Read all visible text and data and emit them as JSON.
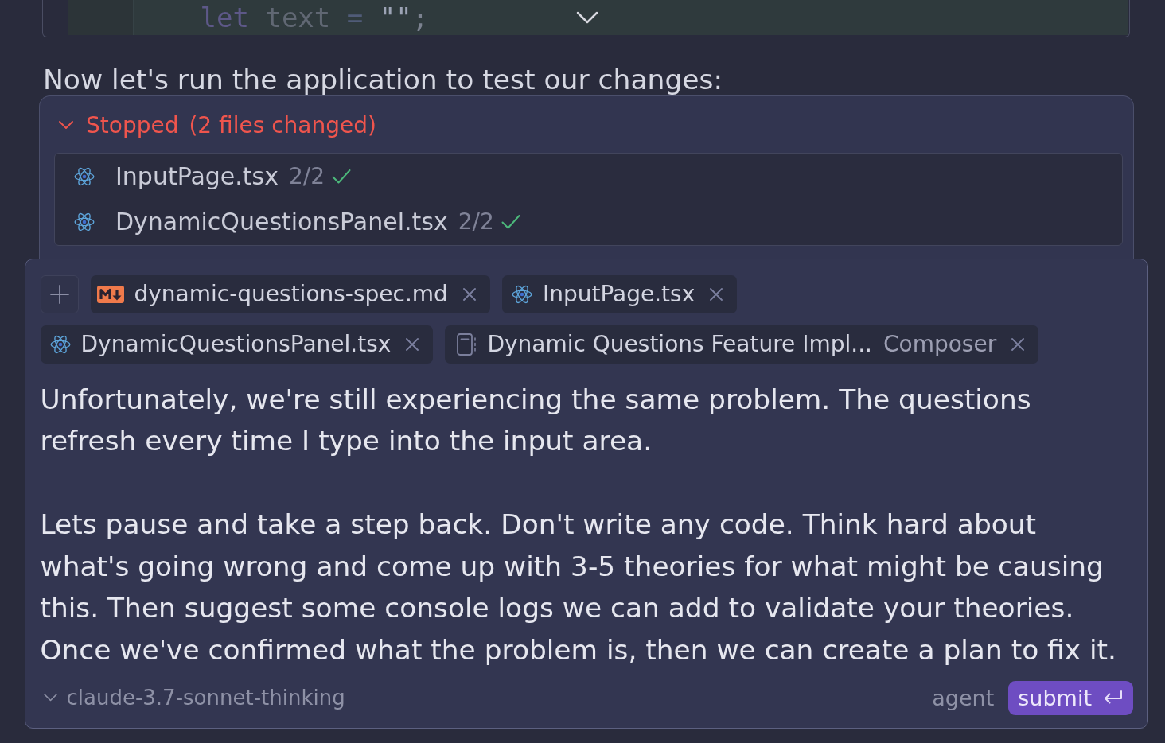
{
  "code_block": {
    "tokens": [
      {
        "kind": "keyword",
        "text": "let"
      },
      {
        "kind": "identifier",
        "text": "text"
      },
      {
        "kind": "operator",
        "text": "="
      },
      {
        "kind": "string",
        "text": "\"\""
      },
      {
        "kind": "punctuation",
        "text": ";"
      }
    ]
  },
  "assistant_text": "Now let's run the application to test our changes:",
  "run_panel": {
    "kind": "stopped",
    "status": "Stopped",
    "summary": "(2 files changed)",
    "expanded": true,
    "files": [
      {
        "kind": "react",
        "name": "InputPage.tsx",
        "progress": "2/2",
        "accepted": true
      },
      {
        "kind": "react",
        "name": "DynamicQuestionsPanel.tsx",
        "progress": "2/2",
        "accepted": true
      }
    ]
  },
  "composer": {
    "chips": [
      {
        "kind": "markdown",
        "label": "dynamic-questions-spec.md"
      },
      {
        "kind": "react",
        "label": "InputPage.tsx"
      },
      {
        "kind": "react",
        "label": "DynamicQuestionsPanel.tsx"
      },
      {
        "kind": "notebook",
        "label": "Dynamic Questions Feature Impl...",
        "detail": "Composer"
      }
    ],
    "message": "Unfortunately, we're still experiencing the same problem. The questions refresh every time I type into the input area.\n\nLets pause and take a step back. Don't write any code. Think hard about what's going wrong and come up with 3-5 theories for what might be causing this. Then suggest some console logs we can add to validate your theories. Once we've confirmed what the problem is, then we can create a plan to fix it.",
    "model": "claude-3.7-sonnet-thinking",
    "mode": "agent",
    "submit": "submit"
  }
}
